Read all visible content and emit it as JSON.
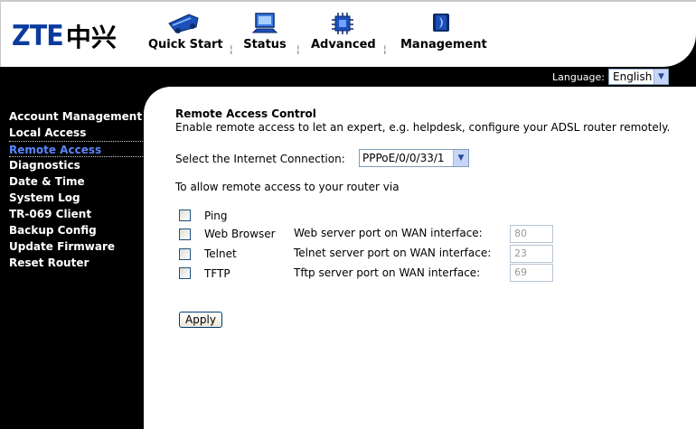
{
  "brand": {
    "logo_text": "ZTE",
    "logo_cn": "中兴"
  },
  "nav": {
    "items": [
      {
        "label": "Quick Start",
        "icon": "quick-start-icon"
      },
      {
        "label": "Status",
        "icon": "status-monitor-icon"
      },
      {
        "label": "Advanced",
        "icon": "advanced-chip-icon"
      },
      {
        "label": "Management",
        "icon": "management-book-icon"
      }
    ],
    "separator": "¦"
  },
  "language": {
    "label": "Language:",
    "value": "English"
  },
  "sidebar": {
    "items": [
      {
        "label": "Account Management"
      },
      {
        "label": "Local Access"
      },
      {
        "label": "Remote Access",
        "active": true
      },
      {
        "label": "Diagnostics"
      },
      {
        "label": "Date & Time"
      },
      {
        "label": "System Log"
      },
      {
        "label": "TR-069 Client"
      },
      {
        "label": "Backup Config"
      },
      {
        "label": "Update Firmware"
      },
      {
        "label": "Reset Router"
      }
    ]
  },
  "main": {
    "title": "Remote Access Control",
    "description": "Enable remote access to let an expert, e.g. helpdesk, configure your ADSL router remotely.",
    "connection_label": "Select the Internet Connection:",
    "connection_value": "PPPoE/0/0/33/1",
    "allow_text": "To allow remote access to your router via",
    "options": [
      {
        "label": "Ping",
        "checked": false
      },
      {
        "label": "Web Browser",
        "checked": false,
        "port_label": "Web server port on WAN interface:",
        "port_value": "80"
      },
      {
        "label": "Telnet",
        "checked": false,
        "port_label": "Telnet server port on WAN interface:",
        "port_value": "23"
      },
      {
        "label": "TFTP",
        "checked": false,
        "port_label": "Tftp server port on WAN interface:",
        "port_value": "69"
      }
    ],
    "apply_label": "Apply"
  },
  "colors": {
    "brand_blue": "#0b3b9e",
    "active_link": "#5b86ff",
    "background": "#000000"
  }
}
